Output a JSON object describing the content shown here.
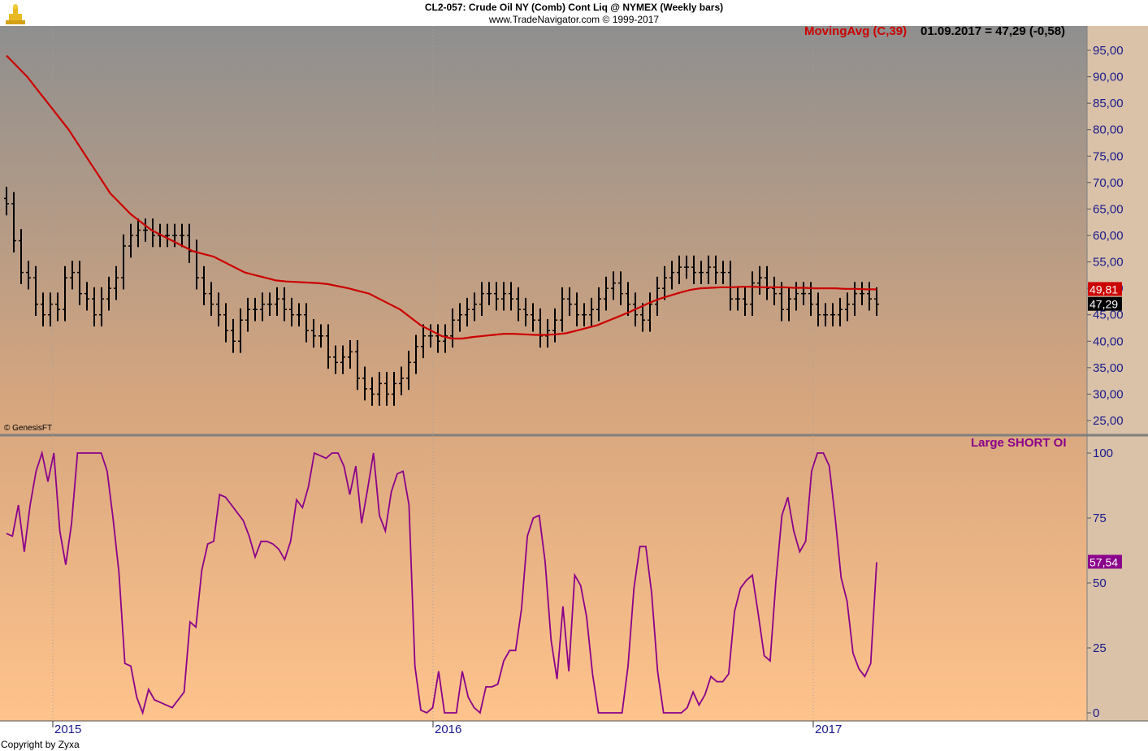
{
  "header": {
    "title": "CL2-057:  Crude Oil NY (Comb) Cont Liq @ NYMEX  (Weekly bars)",
    "subtitle": "www.TradeNavigator.com © 1999-2017",
    "ma_label": "MovingAvg (C,39)",
    "ma_value": "01.09.2017 = 47,29 (-0,58)",
    "indicator_label": "Large SHORT OI",
    "credit": "© GenesisFT",
    "copyright": "Copyright by Zyxa"
  },
  "colors": {
    "bg_top": "#8f8f8f",
    "bg_bottom": "#ffc38c",
    "bars": "#000000",
    "ma": "#cc0000",
    "indicator": "#8b008b",
    "axis_text": "#1a1a8c"
  },
  "chart_data": [
    {
      "type": "ohlc",
      "title": "CL2-057:  Crude Oil NY (Comb) Cont Liq @ NYMEX  (Weekly bars)",
      "ylim": [
        23,
        98
      ],
      "yticks": [
        "95,00",
        "90,00",
        "85,00",
        "80,00",
        "75,00",
        "70,00",
        "65,00",
        "60,00",
        "55,00",
        "50,00",
        "45,00",
        "40,00",
        "35,00",
        "30,00",
        "25,00"
      ],
      "xticks": [
        {
          "label": "2015",
          "week": 3
        },
        {
          "label": "2016",
          "week": 55
        },
        {
          "label": "2017",
          "week": 107
        }
      ],
      "price_badge": "47,29",
      "ma_badge": "49,81",
      "closes": [
        66,
        59,
        53,
        52,
        47,
        45,
        47,
        46,
        52,
        53,
        49,
        48,
        45,
        48,
        50,
        52,
        58,
        60,
        61,
        61,
        60,
        60,
        60,
        60,
        60,
        57,
        52,
        49,
        47,
        45,
        42,
        40,
        44,
        46,
        46,
        47,
        47,
        48,
        46,
        45,
        45,
        42,
        41,
        41,
        37,
        36,
        37,
        38,
        33,
        31,
        30,
        32,
        30,
        32,
        33,
        36,
        39,
        41,
        41,
        40,
        41,
        44,
        45,
        46,
        47,
        49,
        49,
        48,
        49,
        48,
        46,
        45,
        44,
        41,
        42,
        44,
        48,
        47,
        45,
        45,
        46,
        48,
        50,
        51,
        49,
        47,
        45,
        44,
        47,
        50,
        52,
        53,
        54,
        54,
        53,
        53,
        54,
        53,
        53,
        48,
        48,
        47,
        51,
        52,
        50,
        49,
        46,
        48,
        49,
        49,
        47,
        45,
        45,
        45,
        46,
        47,
        49,
        49,
        48,
        47
      ],
      "ma": [
        94,
        92,
        90,
        87.5,
        85,
        82.5,
        80,
        77,
        74,
        71,
        68,
        66,
        64,
        62.5,
        61,
        60,
        59,
        58,
        57,
        56.5,
        56,
        55,
        54,
        53,
        52.5,
        52,
        51.5,
        51.3,
        51.2,
        51.1,
        51,
        50.8,
        50.4,
        50,
        49.5,
        49,
        48,
        47,
        46,
        44.5,
        43,
        42,
        41,
        40.5,
        40.5,
        40.8,
        41,
        41.2,
        41.4,
        41.4,
        41.3,
        41.2,
        41.2,
        41.3,
        41.5,
        42,
        42.5,
        43,
        43.8,
        44.6,
        45.4,
        46.3,
        47.2,
        48,
        48.6,
        49.2,
        49.7,
        50,
        50.1,
        50.2,
        50.2,
        50.3,
        50.3,
        50.2,
        50.2,
        50.2,
        50.1,
        50.1,
        50,
        50,
        50,
        49.9,
        49.9,
        49.8,
        49.8
      ],
      "ma_start_week": 0
    },
    {
      "type": "line",
      "title": "Large SHORT OI",
      "ylim": [
        0,
        100
      ],
      "yticks": [
        "100",
        "75",
        "50",
        "25",
        "0"
      ],
      "value_badge": "57,54",
      "values": [
        69,
        68,
        80,
        62,
        80,
        93,
        100,
        89,
        100,
        70,
        57,
        73,
        100,
        100,
        100,
        100,
        100,
        93,
        75,
        54,
        19,
        18,
        6,
        0,
        9,
        5,
        4,
        3,
        2,
        5,
        8,
        35,
        33,
        55,
        65,
        66,
        84,
        83,
        80,
        77,
        74,
        68,
        60,
        66,
        66,
        65,
        63,
        59,
        66,
        82,
        79,
        87,
        100,
        99,
        98,
        100,
        100,
        95,
        84,
        95,
        73,
        86,
        100,
        76,
        70,
        85,
        92,
        93,
        80,
        18,
        1,
        0,
        2,
        16,
        0,
        0,
        0,
        16,
        6,
        2,
        0,
        10,
        10,
        11,
        20,
        24,
        24,
        40,
        68,
        75,
        76,
        58,
        28,
        13,
        41,
        16,
        53,
        49,
        37,
        15,
        0,
        0,
        0,
        0,
        0,
        18,
        48,
        64,
        64,
        46,
        16,
        0,
        0,
        0,
        0,
        2,
        8,
        3,
        7,
        14,
        12,
        12,
        15,
        39,
        48,
        51,
        53,
        38,
        22,
        20,
        51,
        76,
        83,
        70,
        62,
        66,
        93,
        100,
        100,
        95,
        75,
        52,
        43,
        23,
        17,
        14,
        19,
        58
      ]
    }
  ]
}
